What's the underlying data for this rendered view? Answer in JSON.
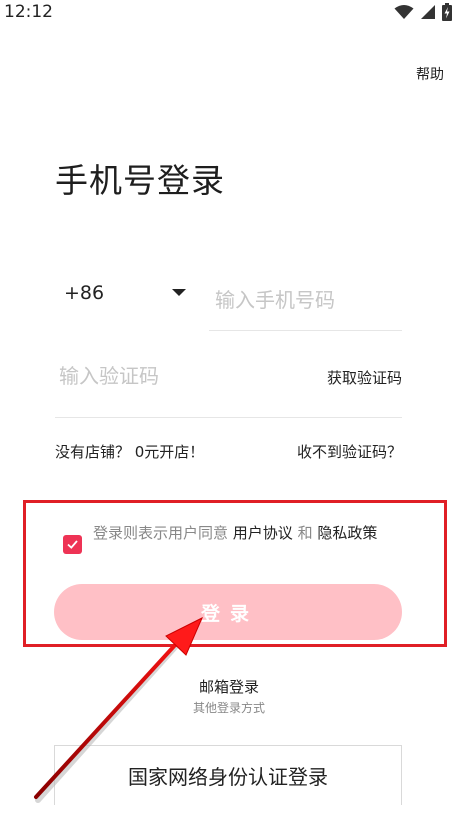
{
  "status_bar": {
    "time": "12:12",
    "icons": [
      "wifi-icon",
      "cellular-signal-icon",
      "battery-charging-icon"
    ]
  },
  "header": {
    "help_label": "帮助"
  },
  "page_title": "手机号登录",
  "phone": {
    "country_code": "+86",
    "placeholder": "输入手机号码",
    "value": ""
  },
  "verification": {
    "placeholder": "输入验证码",
    "value": "",
    "get_code_label": "获取验证码"
  },
  "links": {
    "no_store": "没有店铺？ 0元开店！",
    "no_code": "收不到验证码？"
  },
  "agreement": {
    "checked": true,
    "prefix": "登录则表示用户同意 ",
    "user_agreement": "用户协议",
    "and": " 和 ",
    "privacy_policy": "隐私政策"
  },
  "login_button_label": "登录",
  "alt_login": {
    "email_login": "邮箱登录",
    "other_methods": "其他登录方式"
  },
  "national_id_login": "国家网络身份认证登录",
  "colors": {
    "accent": "#ee3355",
    "login_button_bg": "#ffc0c6",
    "highlight_border": "#e01f26"
  }
}
